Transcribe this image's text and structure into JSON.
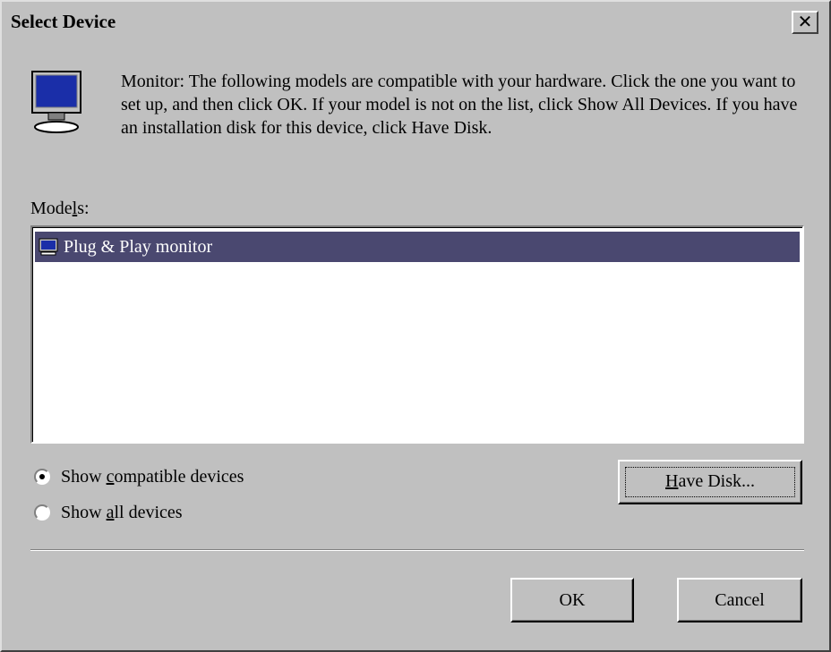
{
  "window": {
    "title": "Select Device",
    "close_label": "✕"
  },
  "description": "Monitor: The following models are compatible with your hardware. Click the one you want to set up, and then click OK. If your model is not on the list, click Show All Devices. If you have an installation disk for this device, click Have Disk.",
  "models": {
    "label_pre": "Mode",
    "label_accel": "l",
    "label_post": "s:",
    "items": [
      {
        "label": "Plug & Play monitor",
        "selected": true
      }
    ]
  },
  "options": {
    "compatible": {
      "pre": "Show ",
      "accel": "c",
      "post": "ompatible devices",
      "checked": true
    },
    "all": {
      "pre": "Show ",
      "accel": "a",
      "post": "ll devices",
      "checked": false
    }
  },
  "buttons": {
    "have_disk": {
      "accel": "H",
      "rest": "ave Disk..."
    },
    "ok": "OK",
    "cancel": "Cancel"
  },
  "colors": {
    "face": "#c0c0c0",
    "selection": "#4a4870",
    "list_bg": "#ffffff"
  },
  "icons": {
    "dialog": "monitor-icon",
    "item": "monitor-small-icon",
    "close": "close-icon"
  }
}
